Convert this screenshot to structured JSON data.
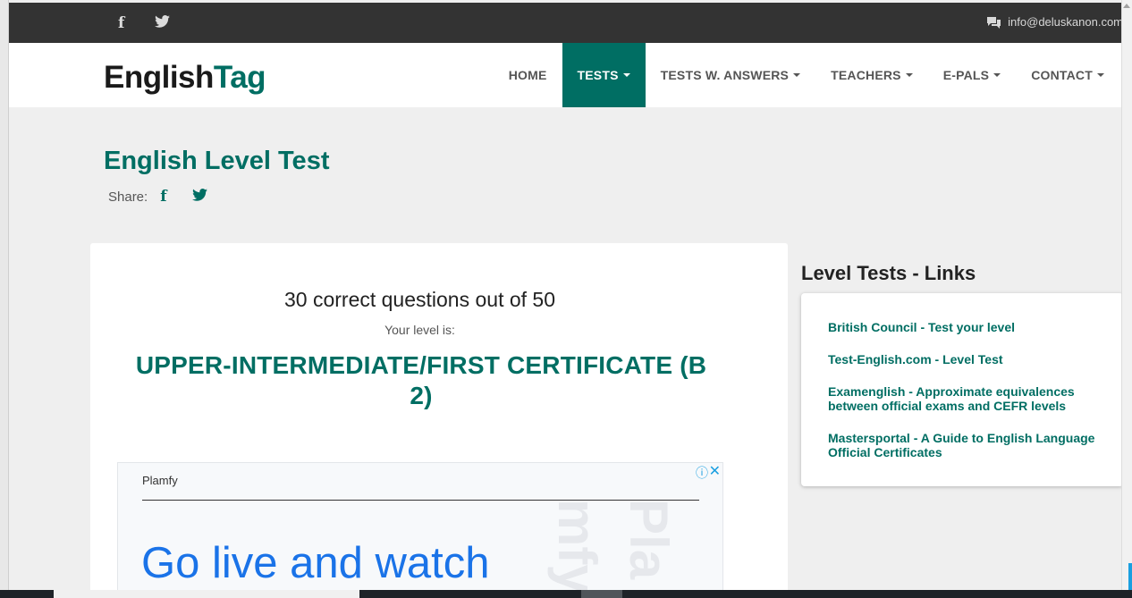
{
  "topbar": {
    "social": [
      {
        "name": "facebook-icon",
        "glyph": "f"
      },
      {
        "name": "twitter-icon",
        "glyph": "🐦"
      }
    ],
    "email": "info@deluskanon.com"
  },
  "brand": {
    "part1": "English",
    "part2": "Tag"
  },
  "nav": {
    "items": [
      {
        "label": "HOME",
        "dropdown": false,
        "active": false
      },
      {
        "label": "TESTS",
        "dropdown": true,
        "active": true
      },
      {
        "label": "TESTS W. ANSWERS",
        "dropdown": true,
        "active": false
      },
      {
        "label": "TEACHERS",
        "dropdown": true,
        "active": false
      },
      {
        "label": "E-PALS",
        "dropdown": true,
        "active": false
      },
      {
        "label": "CONTACT",
        "dropdown": true,
        "active": false
      }
    ]
  },
  "page": {
    "title": "English Level Test",
    "share_label": "Share:"
  },
  "result": {
    "score_text": "30 correct questions out of 50",
    "level_label": "Your level is:",
    "level_line1": "UPPER-INTERMEDIATE/FIRST CERTIFICATE (B",
    "level_line2": "2)"
  },
  "ad": {
    "brand": "Plamfy",
    "headline": "Go live and watch",
    "watermark1": "mfy",
    "watermark2": "Pla"
  },
  "sidebar": {
    "title": "Level Tests - Links",
    "links": [
      {
        "label": "British Council - Test your level"
      },
      {
        "label": "Test-English.com - Level Test"
      },
      {
        "label": "Examenglish - Approximate equivalences between official exams and CEFR levels"
      },
      {
        "label": "Mastersportal - A Guide to English Language Official Certificates"
      }
    ]
  },
  "colors": {
    "accent": "#006e63",
    "topbar": "#333333",
    "ad_blue": "#1a73e8"
  }
}
